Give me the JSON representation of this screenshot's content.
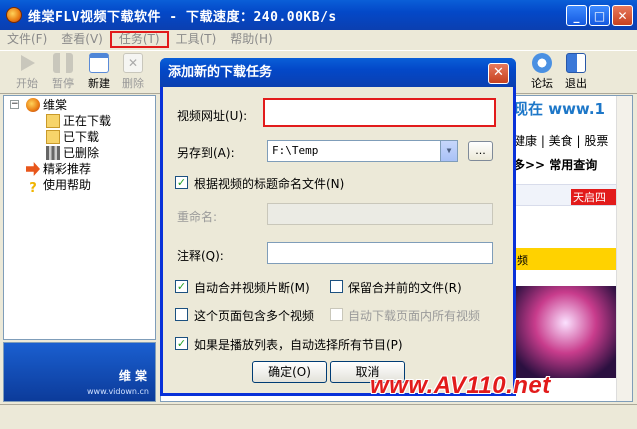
{
  "window": {
    "title": "维棠FLV视频下载软件 - 下载速度：240.00KB/s",
    "minimize": "_",
    "maximize": "□",
    "close": "✕"
  },
  "menu": [
    "文件(F)",
    "查看(V)",
    "任务(T)",
    "工具(T)",
    "帮助(H)"
  ],
  "toolbar": {
    "start": "开始",
    "pause": "暂停",
    "new": "新建",
    "delete": "删除",
    "forum": "论坛",
    "exit": "退出"
  },
  "tree": {
    "root": "维棠",
    "downloading": "正在下载",
    "downloaded": "已下载",
    "deleted": "已删除",
    "recommend": "精彩推荐",
    "help": "使用帮助"
  },
  "banner": {
    "brand": "维 棠",
    "url": "www.vidown.cn"
  },
  "web_preview": {
    "line1": "现在 www.1",
    "links": "健康 | 美食 | 股票",
    "more": "多>> 常用查询",
    "side_tag": "天启四",
    "bar": "频"
  },
  "dialog": {
    "title": "添加新的下载任务",
    "url_label": "视频网址(U):",
    "url_value": "",
    "saveto_label": "另存到(A):",
    "saveto_value": "F:\\Temp",
    "browse": "...",
    "name_by_title": "根据视频的标题命名文件(N)",
    "rename_label": "重命名:",
    "rename_value": "",
    "note_label": "注释(Q):",
    "note_value": "",
    "auto_merge": "自动合并视频片断(M)",
    "keep_before_merge": "保留合并前的文件(R)",
    "multi_video": "这个页面包含多个视频",
    "auto_download_all": "自动下载页面内所有视频",
    "playlist": "如果是播放列表，自动选择所有节目(P)",
    "ok": "确定(O)",
    "cancel": "取消"
  },
  "checkboxes": {
    "name_by_title": true,
    "auto_merge": true,
    "keep_before_merge": false,
    "multi_video": false,
    "auto_download_all": false,
    "playlist": true
  },
  "watermark": "www.AV110.net"
}
